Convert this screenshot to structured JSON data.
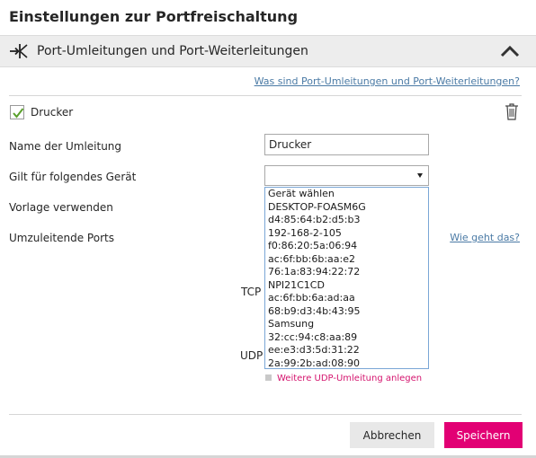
{
  "page": {
    "title": "Einstellungen zur Portfreischaltung"
  },
  "section": {
    "title": "Port-Umleitungen und Port-Weiterleitungen",
    "help_link": "Was sind Port-Umleitungen und Port-Weiterleitungen?"
  },
  "entry": {
    "checkbox_label": "Drucker",
    "checked": true,
    "name_label": "Name der Umleitung",
    "name_value": "Drucker",
    "device_label": "Gilt für folgendes Gerät",
    "device_selected": "",
    "template_label": "Vorlage verwenden",
    "ports_label": "Umzuleitende Ports",
    "ports_help_link": "Wie geht das?",
    "tcp_label": "TCP",
    "udp_label": "UDP",
    "add_udp_label": "Weitere UDP-Umleitung anlegen"
  },
  "device_options": [
    "Gerät wählen",
    "DESKTOP-FOASM6G",
    "d4:85:64:b2:d5:b3",
    "192-168-2-105",
    "f0:86:20:5a:06:94",
    "ac:6f:bb:6b:aa:e2",
    "76:1a:83:94:22:72",
    "NPI21C1CD",
    "ac:6f:bb:6a:ad:aa",
    "68:b9:d3:4b:43:95",
    "Samsung",
    "32:cc:94:c8:aa:89",
    "ee:e3:d3:5d:31:22",
    "2a:99:2b:ad:08:90"
  ],
  "buttons": {
    "cancel": "Abbrechen",
    "save": "Speichern"
  },
  "colors": {
    "accent": "#e20074",
    "link": "#4a7aa5",
    "check": "#5aa02c"
  },
  "icons": {
    "section": "port-forward-icon",
    "collapse": "chevron-up-icon",
    "delete": "trash-icon",
    "checkbox": "checkmark-icon"
  }
}
